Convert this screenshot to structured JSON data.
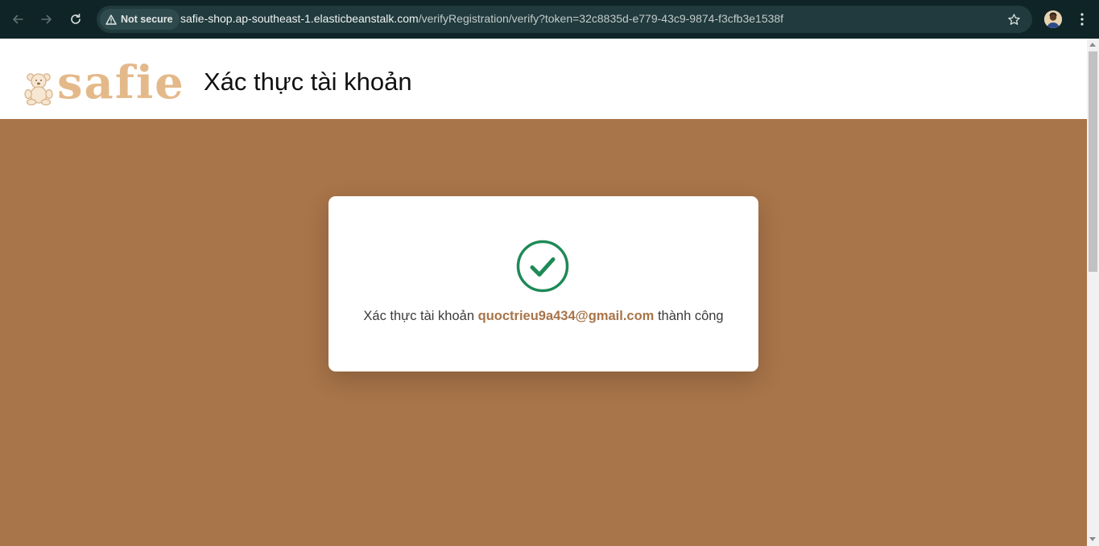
{
  "browser": {
    "security_label": "Not secure",
    "url_host": "safie-shop.ap-southeast-1.elasticbeanstalk.com",
    "url_path": "/verifyRegistration/verify?token=32c8835d-e779-43c9-9874-f3cfb3e1538f",
    "icons": {
      "back": "arrow-left-icon",
      "forward": "arrow-right-icon",
      "reload": "reload-icon",
      "warning": "warning-triangle-icon",
      "bookmark": "star-icon",
      "profile": "avatar",
      "menu": "kebab-menu-icon"
    }
  },
  "header": {
    "logo_text": "safie",
    "title": "Xác thực tài khoản"
  },
  "card": {
    "message_prefix": "Xác thực tài khoản",
    "email": "quoctrieu9a434@gmail.com",
    "message_suffix": "thành công",
    "icon": "check-circle-icon"
  },
  "colors": {
    "page_background": "#a87449",
    "brand_accent": "#a87449",
    "success_green": "#1e8a57",
    "chrome_dark": "#0f2426",
    "logo_tan": "#e4b98a"
  }
}
